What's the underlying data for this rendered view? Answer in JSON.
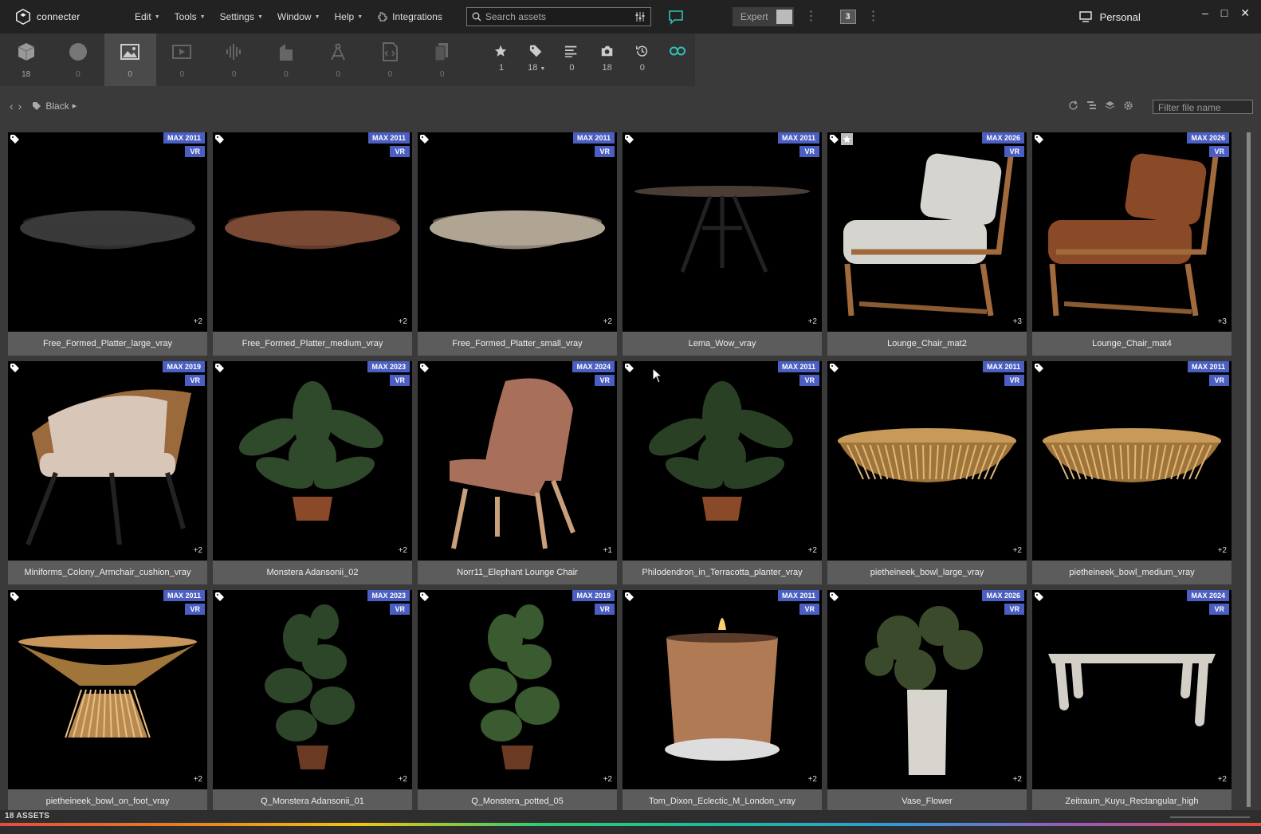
{
  "app": {
    "name": "connecter"
  },
  "menu": [
    {
      "label": "Edit",
      "caret": true
    },
    {
      "label": "Tools",
      "caret": true
    },
    {
      "label": "Settings",
      "caret": true
    },
    {
      "label": "Window",
      "caret": true
    },
    {
      "label": "Help",
      "caret": true
    }
  ],
  "integrations": {
    "label": "Integrations"
  },
  "search": {
    "placeholder": "Search assets"
  },
  "expert": {
    "label": "Expert"
  },
  "notification_badge": "3",
  "workspace": {
    "label": "Personal"
  },
  "window_controls": {
    "minimize": "–",
    "maximize": "□",
    "close": "✕"
  },
  "type_bar": [
    {
      "icon": "cube-icon",
      "count": "18",
      "active": false,
      "caret": true
    },
    {
      "icon": "sphere-icon",
      "count": "0",
      "active": false
    },
    {
      "icon": "image-icon",
      "count": "0",
      "active": true
    },
    {
      "icon": "video-icon",
      "count": "0",
      "active": false
    },
    {
      "icon": "audio-icon",
      "count": "0",
      "active": false
    },
    {
      "icon": "building-icon",
      "count": "0",
      "active": false
    },
    {
      "icon": "drafting-icon",
      "count": "0",
      "active": false
    },
    {
      "icon": "code-file-icon",
      "count": "0",
      "active": false
    },
    {
      "icon": "documents-icon",
      "count": "0",
      "active": false
    }
  ],
  "filter_bar": [
    {
      "icon": "star-icon",
      "count": "1"
    },
    {
      "icon": "tag-icon",
      "count": "18",
      "caret": true
    },
    {
      "icon": "list-icon",
      "count": "0"
    },
    {
      "icon": "camera-icon",
      "count": "18"
    },
    {
      "icon": "history-icon",
      "count": "0"
    },
    {
      "icon": "infinity-icon",
      "count": ""
    }
  ],
  "breadcrumb": {
    "back": "‹",
    "forward": "›",
    "tag": "Black"
  },
  "filter_file": {
    "placeholder": "Filter file name"
  },
  "colors": {
    "accent_badge": "#4a5fc1",
    "infinity": "#2ec4b6",
    "chat": "#2ec4b6"
  },
  "assets": [
    {
      "name": "Free_Formed_Platter_large_vray",
      "version": "MAX 2011",
      "vr": "VR",
      "extra": "+2",
      "starred": false,
      "kind": "platter",
      "color": "#3a3a3a"
    },
    {
      "name": "Free_Formed_Platter_medium_vray",
      "version": "MAX 2011",
      "vr": "VR",
      "extra": "+2",
      "starred": false,
      "kind": "platter",
      "color": "#7a4a35"
    },
    {
      "name": "Free_Formed_Platter_small_vray",
      "version": "MAX 2011",
      "vr": "VR",
      "extra": "+2",
      "starred": false,
      "kind": "platter",
      "color": "#b0a593"
    },
    {
      "name": "Lema_Wow_vray",
      "version": "MAX 2011",
      "vr": "VR",
      "extra": "+2",
      "starred": false,
      "kind": "table",
      "color": "#4a3d36"
    },
    {
      "name": "Lounge_Chair_mat2",
      "version": "MAX 2026",
      "vr": "VR",
      "extra": "+3",
      "starred": true,
      "kind": "lounge",
      "color": "#d6d4cf"
    },
    {
      "name": "Lounge_Chair_mat4",
      "version": "MAX 2026",
      "vr": "VR",
      "extra": "+3",
      "starred": false,
      "kind": "lounge",
      "color": "#8a4a28"
    },
    {
      "name": "Miniforms_Colony_Armchair_cushion_vray",
      "version": "MAX 2019",
      "vr": "VR",
      "extra": "+2",
      "starred": false,
      "kind": "armchair",
      "color": "#d8c7b8"
    },
    {
      "name": "Monstera Adansonii_02",
      "version": "MAX 2023",
      "vr": "VR",
      "extra": "+2",
      "starred": false,
      "kind": "plant",
      "color": "#2f4a2a"
    },
    {
      "name": "Norr11_Elephant Lounge Chair",
      "version": "MAX 2024",
      "vr": "VR",
      "extra": "+1",
      "starred": false,
      "kind": "elephant",
      "color": "#a8705a"
    },
    {
      "name": "Philodendron_in_Terracotta_planter_vray",
      "version": "MAX 2011",
      "vr": "VR",
      "extra": "+2",
      "starred": false,
      "kind": "plant",
      "color": "#2a4025"
    },
    {
      "name": "pietheineek_bowl_large_vray",
      "version": "MAX 2011",
      "vr": "VR",
      "extra": "+2",
      "starred": false,
      "kind": "basket",
      "color": "#c89a5a"
    },
    {
      "name": "pietheineek_bowl_medium_vray",
      "version": "MAX 2011",
      "vr": "VR",
      "extra": "+2",
      "starred": false,
      "kind": "basket",
      "color": "#c89a5a"
    },
    {
      "name": "pietheineek_bowl_on_foot_vray",
      "version": "MAX 2011",
      "vr": "VR",
      "extra": "+2",
      "starred": false,
      "kind": "footbowl",
      "color": "#c8955a"
    },
    {
      "name": "Q_Monstera Adansonii_01",
      "version": "MAX 2023",
      "vr": "VR",
      "extra": "+2",
      "starred": false,
      "kind": "tallplant",
      "color": "#2d4528"
    },
    {
      "name": "Q_Monstera_potted_05",
      "version": "MAX 2019",
      "vr": "VR",
      "extra": "+2",
      "starred": false,
      "kind": "tallplant",
      "color": "#3a5a30"
    },
    {
      "name": "Tom_Dixon_Eclectic_M_London_vray",
      "version": "MAX 2011",
      "vr": "VR",
      "extra": "+2",
      "starred": false,
      "kind": "candle",
      "color": "#b07a55"
    },
    {
      "name": "Vase_Flower",
      "version": "MAX 2026",
      "vr": "VR",
      "extra": "+2",
      "starred": false,
      "kind": "vase",
      "color": "#d8d4ce"
    },
    {
      "name": "Zeitraum_Kuyu_Rectangular_high",
      "version": "MAX 2024",
      "vr": "VR",
      "extra": "+2",
      "starred": false,
      "kind": "desk",
      "color": "#d4cfc6"
    }
  ],
  "status": {
    "asset_count": "18 ASSETS"
  }
}
